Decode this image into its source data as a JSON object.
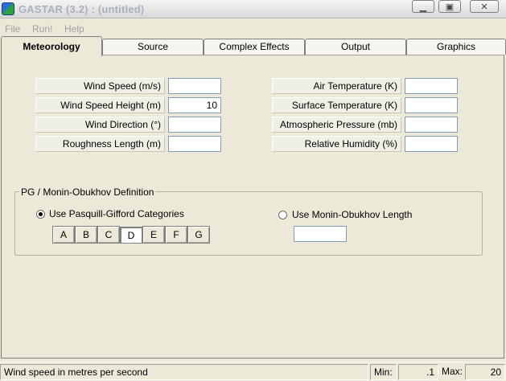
{
  "window": {
    "title": "GASTAR (3.2) : (untitled)",
    "minimize_glyph": "▁",
    "maximize_glyph": "▣",
    "close_glyph": "✕"
  },
  "menu": {
    "items": [
      "File",
      "Run!",
      "Help"
    ]
  },
  "tabs": [
    "Meteorology",
    "Source",
    "Complex Effects",
    "Output",
    "Graphics"
  ],
  "active_tab": "Meteorology",
  "fields_left": [
    {
      "label": "Wind Speed (m/s)",
      "value": ""
    },
    {
      "label": "Wind Speed Height (m)",
      "value": "10"
    },
    {
      "label": "Wind Direction (°)",
      "value": ""
    },
    {
      "label": "Roughness Length (m)",
      "value": ""
    }
  ],
  "fields_right": [
    {
      "label": "Air Temperature (K)",
      "value": ""
    },
    {
      "label": "Surface Temperature (K)",
      "value": ""
    },
    {
      "label": "Atmospheric Pressure (mb)",
      "value": ""
    },
    {
      "label": "Relative Humidity (%)",
      "value": ""
    }
  ],
  "pg_group": {
    "title": "PG / Monin-Obukhov Definition",
    "option_pg": "Use Pasquill-Gifford Categories",
    "option_mo": "Use Monin-Obukhov Length",
    "selected_option": "Use Pasquill-Gifford Categories",
    "categories": [
      "A",
      "B",
      "C",
      "D",
      "E",
      "F",
      "G"
    ],
    "selected_category": "D",
    "mo_length_value": ""
  },
  "status": {
    "message": "Wind speed in metres per second",
    "min_label": "Min:",
    "min_value": ".1",
    "max_label": "Max:",
    "max_value": "20"
  },
  "colors": {
    "window_bg": "#ece9d8",
    "title_text": "#aab0bc",
    "input_border": "#7f9db9"
  }
}
